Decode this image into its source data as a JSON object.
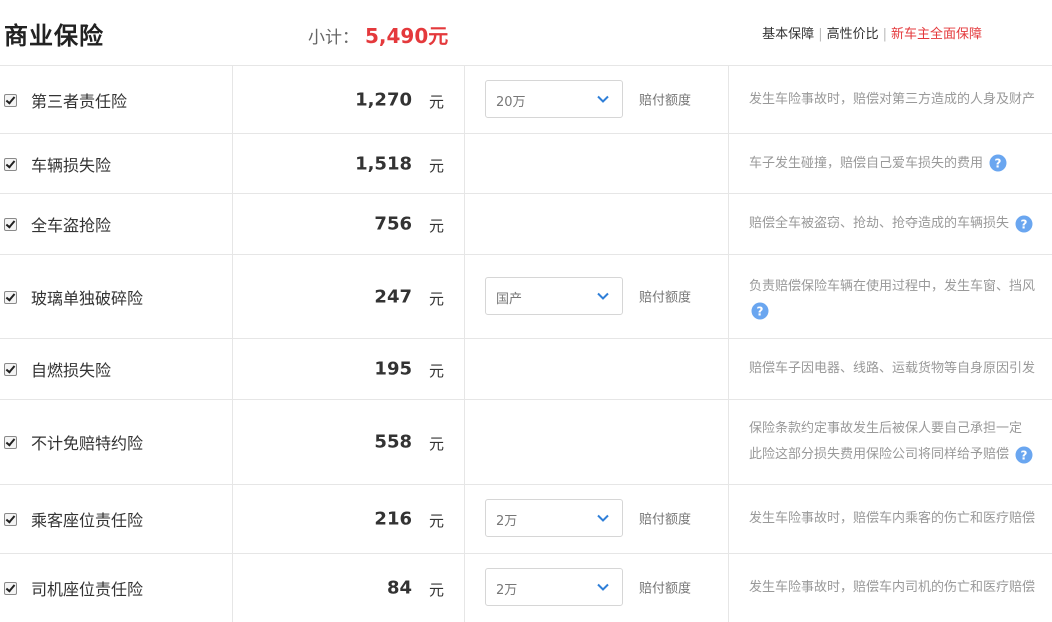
{
  "header": {
    "title": "商业保险",
    "subtotal_label": "小计：",
    "subtotal_amount": "5,490元",
    "plans": [
      {
        "label": "基本保障"
      },
      {
        "label": "高性价比"
      },
      {
        "label": "新车主全面保障"
      }
    ],
    "plan_separator": "|"
  },
  "rows": [
    {
      "name": "第三者责任险",
      "checked": true,
      "price": "1,270",
      "unit": "元",
      "option": "20万",
      "option_label": "赔付额度",
      "desc": "发生车险事故时，赔偿对第三方造成的人身及财产"
    },
    {
      "name": "车辆损失险",
      "checked": true,
      "price": "1,518",
      "unit": "元",
      "desc": "车子发生碰撞，赔偿自己爱车损失的费用"
    },
    {
      "name": "全车盗抢险",
      "checked": true,
      "price": "756",
      "unit": "元",
      "desc": "赔偿全车被盗窃、抢劫、抢夺造成的车辆损失"
    },
    {
      "name": "玻璃单独破碎险",
      "checked": true,
      "price": "247",
      "unit": "元",
      "option": "国产",
      "option_label": "赔付额度",
      "desc": "负责赔偿保险车辆在使用过程中，发生车窗、挡风"
    },
    {
      "name": "自燃损失险",
      "checked": true,
      "price": "195",
      "unit": "元",
      "desc": "赔偿车子因电器、线路、运载货物等自身原因引发"
    },
    {
      "name": "不计免赔特约险",
      "checked": true,
      "price": "558",
      "unit": "元",
      "desc_line1": "保险条款约定事故发生后被保人要自己承担一定",
      "desc_line2": "此险这部分损失费用保险公司将同样给予赔偿"
    },
    {
      "name": "乘客座位责任险",
      "checked": true,
      "price": "216",
      "unit": "元",
      "option": "2万",
      "option_label": "赔付额度",
      "desc": "发生车险事故时，赔偿车内乘客的伤亡和医疗赔偿"
    },
    {
      "name": "司机座位责任险",
      "checked": true,
      "price": "84",
      "unit": "元",
      "option": "2万",
      "option_label": "赔付额度",
      "desc": "发生车险事故时，赔偿车内司机的伤亡和医疗赔偿"
    }
  ],
  "colors": {
    "accent_red": "#e4393c",
    "help_icon": "#6aa6f0",
    "border": "#e6e6e6"
  },
  "icons": {
    "help": "question-circle-icon",
    "dropdown": "chevron-down-icon",
    "checkbox": "checkbox-checked"
  }
}
